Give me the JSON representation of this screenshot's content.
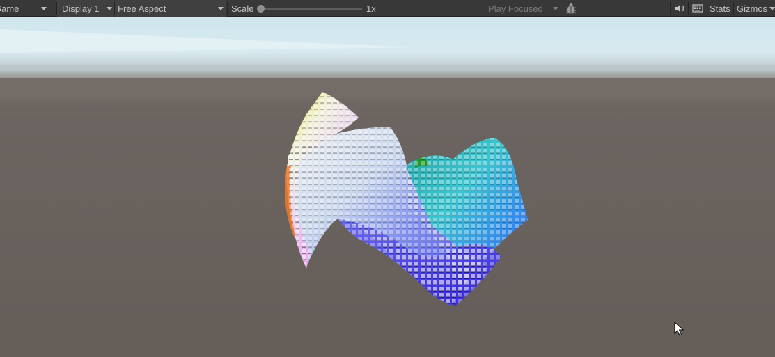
{
  "toolbar": {
    "game_tab_label": "Game",
    "display_label": "Display 1",
    "aspect_label": "Free Aspect",
    "scale_label": "Scale",
    "scale_value": "1x",
    "scale_slider_fraction": 0.0,
    "play_mode_label": "Play Focused",
    "stats_label": "Stats",
    "gizmos_label": "Gizmos",
    "icons": [
      "chevron-down-icon",
      "bug-icon",
      "speaker-icon",
      "keyboard-icon"
    ]
  },
  "scene": {
    "sky_color": "#cfe6ee",
    "ground_color": "#655d58",
    "surface_color_gradient": [
      "#f07a2a",
      "#d8d83a",
      "#ffffff",
      "#3ad6d8",
      "#2a70ff",
      "#3a3ae8",
      "#f2a8f0"
    ]
  }
}
